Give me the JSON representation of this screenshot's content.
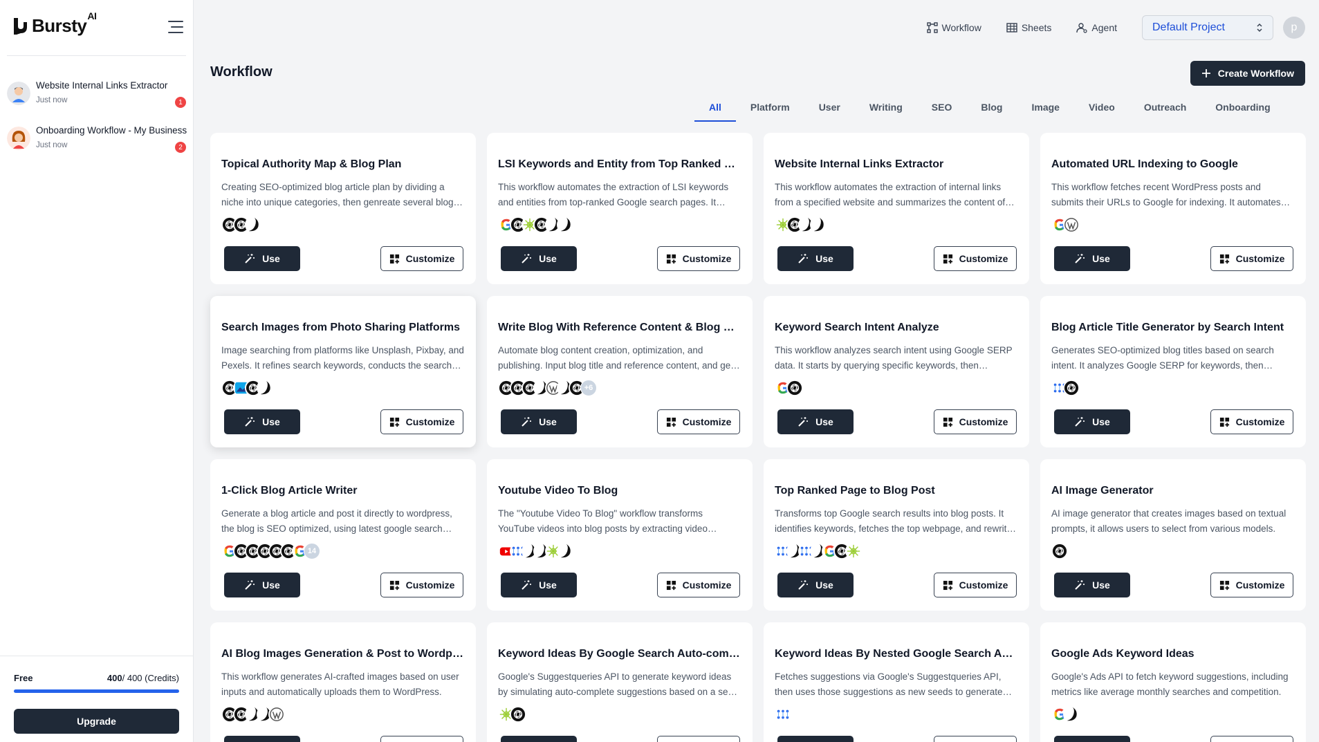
{
  "brand": {
    "name": "Bursty",
    "sup": "AI"
  },
  "history": [
    {
      "title": "Website Internal Links Extractor",
      "time": "Just now",
      "badge": "1"
    },
    {
      "title": "Onboarding Workflow - My Business",
      "time": "Just now",
      "badge": "2"
    }
  ],
  "credits": {
    "plan": "Free",
    "used": "400",
    "total": "/ 400 (Credits)",
    "fraction": 1.0,
    "upgrade_label": "Upgrade"
  },
  "topnav": {
    "workflow": "Workflow",
    "sheets": "Sheets",
    "agent": "Agent",
    "project": "Default Project",
    "avatar_letter": "p"
  },
  "page": {
    "title": "Workflow",
    "create_label": "Create Workflow"
  },
  "tabs": [
    "All",
    "Platform",
    "User",
    "Writing",
    "SEO",
    "Blog",
    "Image",
    "Video",
    "Outreach",
    "Onboarding"
  ],
  "labels": {
    "use": "Use",
    "customize": "Customize"
  },
  "colors": {
    "primary_dark": "#1f2937",
    "accent_blue": "#1d4ed8",
    "badge_red": "#ef4444"
  },
  "cards": [
    {
      "title": "Topical Authority Map & Blog Plan",
      "desc": "Creating SEO-optimized blog article plan by dividing a niche into unique categories, then genreate several blog post ideas for each.",
      "icons": [
        "openai",
        "openai",
        "claude"
      ]
    },
    {
      "title": "LSI Keywords and Entity from Top Ranked Pages",
      "desc": "This workflow automates the extraction of LSI keywords and entities from top-ranked Google search pages. It analyzes content.",
      "icons": [
        "google",
        "openai",
        "perplexity",
        "openai",
        "claude",
        "claude"
      ]
    },
    {
      "title": "Website Internal Links Extractor",
      "desc": "This workflow automates the extraction of internal links from a specified website and summarizes the content of each page.",
      "icons": [
        "perplexity",
        "openai",
        "claude",
        "claude"
      ]
    },
    {
      "title": "Automated URL Indexing to Google",
      "desc": "This workflow fetches recent WordPress posts and submits their URLs to Google for indexing. It automates the process.",
      "icons": [
        "google",
        "wordpress"
      ]
    },
    {
      "title": "Search Images from Photo Sharing Platforms",
      "desc": "Image searching from platforms like Unsplash, Pixbay, and Pexels. It refines search keywords, conducts the search and returns results.",
      "icons": [
        "openai",
        "image",
        "openai",
        "claude"
      ]
    },
    {
      "title": "Write Blog With Reference Content & Blog Post",
      "desc": "Automate blog content creation, optimization, and publishing. Input blog title and reference content, and get a full post.",
      "icons": [
        "openai",
        "openai",
        "openai",
        "claude",
        "wordpress",
        "claude",
        "openai"
      ],
      "more": "+6"
    },
    {
      "title": "Keyword Search Intent Analyze",
      "desc": "This workflow analyzes search intent using Google SERP data. It starts by querying specific keywords, then classifies them.",
      "icons": [
        "google",
        "openai"
      ]
    },
    {
      "title": "Blog Article Title Generator by Search Intent",
      "desc": "Generates SEO-optimized blog titles based on search intent. It analyzes Google SERP for keywords, then creates titles.",
      "icons": [
        "dots",
        "openai"
      ]
    },
    {
      "title": "1-Click Blog Article Writer",
      "desc": "Generate a blog article and post it directly to wordpress, the blog is SEO optimized, using latest google search results.",
      "icons": [
        "google",
        "openai",
        "openai",
        "openai",
        "openai",
        "openai",
        "google"
      ],
      "more": "14"
    },
    {
      "title": "Youtube Video To Blog",
      "desc": "The \"Youtube Video To Blog\" workflow transforms YouTube videos into blog posts by extracting video transcripts.",
      "icons": [
        "youtube",
        "dots",
        "claude",
        "claude",
        "perplexity",
        "claude"
      ]
    },
    {
      "title": "Top Ranked Page to Blog Post",
      "desc": "Transforms top Google search results into blog posts. It identifies keywords, fetches the top webpage, and rewrites it.",
      "icons": [
        "dots",
        "claude",
        "dots",
        "claude",
        "google",
        "openai",
        "perplexity"
      ]
    },
    {
      "title": "AI Image Generator",
      "desc": "AI image generator that creates images based on textual prompts, it allows users to select from various models.",
      "icons": [
        "openai"
      ]
    },
    {
      "title": "AI Blog Images Generation & Post to Wordpress",
      "desc": "This workflow generates AI-crafted images based on user inputs and automatically uploads them to WordPress.",
      "icons": [
        "openai",
        "openai",
        "claude",
        "claude",
        "wordpress"
      ]
    },
    {
      "title": "Keyword Ideas By Google Search Auto-complete",
      "desc": "Google's Suggestqueries API to generate keyword ideas by simulating auto-complete suggestions based on a seed keyword.",
      "icons": [
        "perplexity",
        "openai"
      ]
    },
    {
      "title": "Keyword Ideas By Nested Google Search Auto-complete",
      "desc": "Fetches suggestions via Google's Suggestqueries API, then uses those suggestions as new seeds to generate more ideas.",
      "icons": [
        "dots"
      ]
    },
    {
      "title": "Google Ads Keyword Ideas",
      "desc": "Google's Ads API to fetch keyword suggestions, including metrics like average monthly searches and competition.",
      "icons": [
        "google",
        "claude"
      ]
    }
  ]
}
